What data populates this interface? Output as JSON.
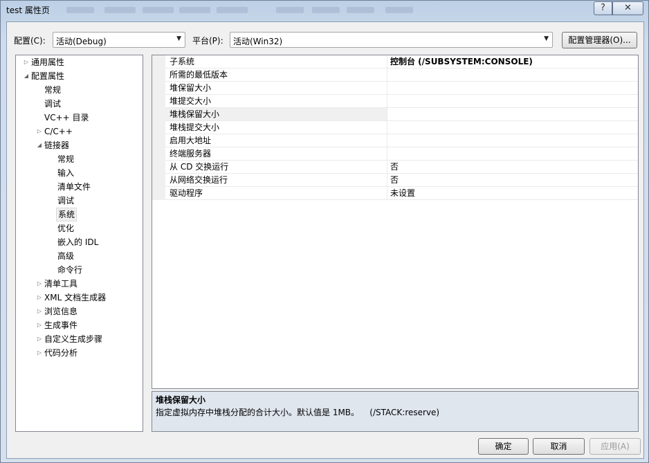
{
  "window": {
    "title": "test 属性页",
    "help_glyph": "?",
    "close_glyph": "✕"
  },
  "config_row": {
    "config_label": "配置(C):",
    "config_value": "活动(Debug)",
    "platform_label": "平台(P):",
    "platform_value": "活动(Win32)",
    "config_manager_label": "配置管理器(O)..."
  },
  "tree": {
    "items": [
      {
        "label": "通用属性",
        "level": 0,
        "expander": "collapsed"
      },
      {
        "label": "配置属性",
        "level": 0,
        "expander": "expanded"
      },
      {
        "label": "常规",
        "level": 1,
        "expander": "none"
      },
      {
        "label": "调试",
        "level": 1,
        "expander": "none"
      },
      {
        "label": "VC++ 目录",
        "level": 1,
        "expander": "none"
      },
      {
        "label": "C/C++",
        "level": 1,
        "expander": "collapsed"
      },
      {
        "label": "链接器",
        "level": 1,
        "expander": "expanded"
      },
      {
        "label": "常规",
        "level": 2,
        "expander": "none"
      },
      {
        "label": "输入",
        "level": 2,
        "expander": "none"
      },
      {
        "label": "清单文件",
        "level": 2,
        "expander": "none"
      },
      {
        "label": "调试",
        "level": 2,
        "expander": "none"
      },
      {
        "label": "系统",
        "level": 2,
        "expander": "none",
        "selected": true
      },
      {
        "label": "优化",
        "level": 2,
        "expander": "none"
      },
      {
        "label": "嵌入的 IDL",
        "level": 2,
        "expander": "none"
      },
      {
        "label": "高级",
        "level": 2,
        "expander": "none"
      },
      {
        "label": "命令行",
        "level": 2,
        "expander": "none"
      },
      {
        "label": "清单工具",
        "level": 1,
        "expander": "collapsed"
      },
      {
        "label": "XML 文档生成器",
        "level": 1,
        "expander": "collapsed"
      },
      {
        "label": "浏览信息",
        "level": 1,
        "expander": "collapsed"
      },
      {
        "label": "生成事件",
        "level": 1,
        "expander": "collapsed"
      },
      {
        "label": "自定义生成步骤",
        "level": 1,
        "expander": "collapsed"
      },
      {
        "label": "代码分析",
        "level": 1,
        "expander": "collapsed"
      }
    ]
  },
  "properties": {
    "rows": [
      {
        "name": "子系统",
        "value": "控制台 (/SUBSYSTEM:CONSOLE)",
        "bold": true
      },
      {
        "name": "所需的最低版本",
        "value": ""
      },
      {
        "name": "堆保留大小",
        "value": ""
      },
      {
        "name": "堆提交大小",
        "value": ""
      },
      {
        "name": "堆栈保留大小",
        "value": "",
        "selected": true
      },
      {
        "name": "堆栈提交大小",
        "value": ""
      },
      {
        "name": "启用大地址",
        "value": ""
      },
      {
        "name": "终端服务器",
        "value": ""
      },
      {
        "name": "从 CD 交换运行",
        "value": "否"
      },
      {
        "name": "从网络交换运行",
        "value": "否"
      },
      {
        "name": "驱动程序",
        "value": "未设置"
      }
    ]
  },
  "description": {
    "title": "堆栈保留大小",
    "text": "指定虚拟内存中堆栈分配的合计大小。默认值是 1MB。    (/STACK:reserve)"
  },
  "footer": {
    "ok_label": "确定",
    "cancel_label": "取消",
    "apply_label": "应用(A)"
  },
  "icons": {
    "collapsed": "▷",
    "expanded": "◢",
    "dropdown": "▼"
  }
}
